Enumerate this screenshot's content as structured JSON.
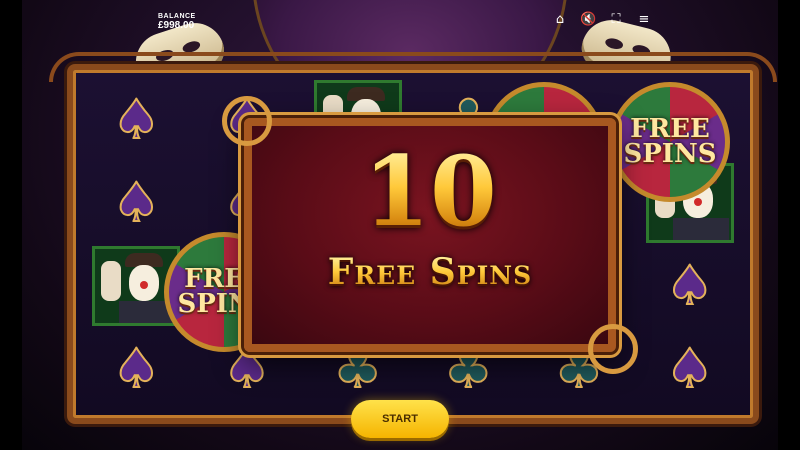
{
  "balance": {
    "label": "BALANCE",
    "value": "£998.00"
  },
  "top_icons": [
    {
      "name": "home-icon",
      "glyph": "⌂"
    },
    {
      "name": "sound-off-icon",
      "glyph": "🔇"
    },
    {
      "name": "fullscreen-icon",
      "glyph": "⛶"
    },
    {
      "name": "menu-icon",
      "glyph": "≡"
    }
  ],
  "reels": [
    [
      "spade",
      "spade",
      "clown",
      "spade"
    ],
    [
      "spade",
      "spade",
      "freespins",
      "spade"
    ],
    [
      "clown",
      "club",
      "club",
      "club"
    ],
    [
      "club",
      "spade",
      "club",
      "club"
    ],
    [
      "freespins",
      "spade",
      "club",
      "club"
    ],
    [
      "freespins",
      "clown",
      "spade",
      "spade"
    ]
  ],
  "free_spins_symbol": {
    "line1": "FREE",
    "line2": "SPINS"
  },
  "modal": {
    "count": "10",
    "label": "Free Spins"
  },
  "start_button": {
    "label": "START"
  },
  "colors": {
    "gold": "#ffc93a",
    "modal_red": "#5a0c17",
    "button_yellow": "#f5b400"
  }
}
